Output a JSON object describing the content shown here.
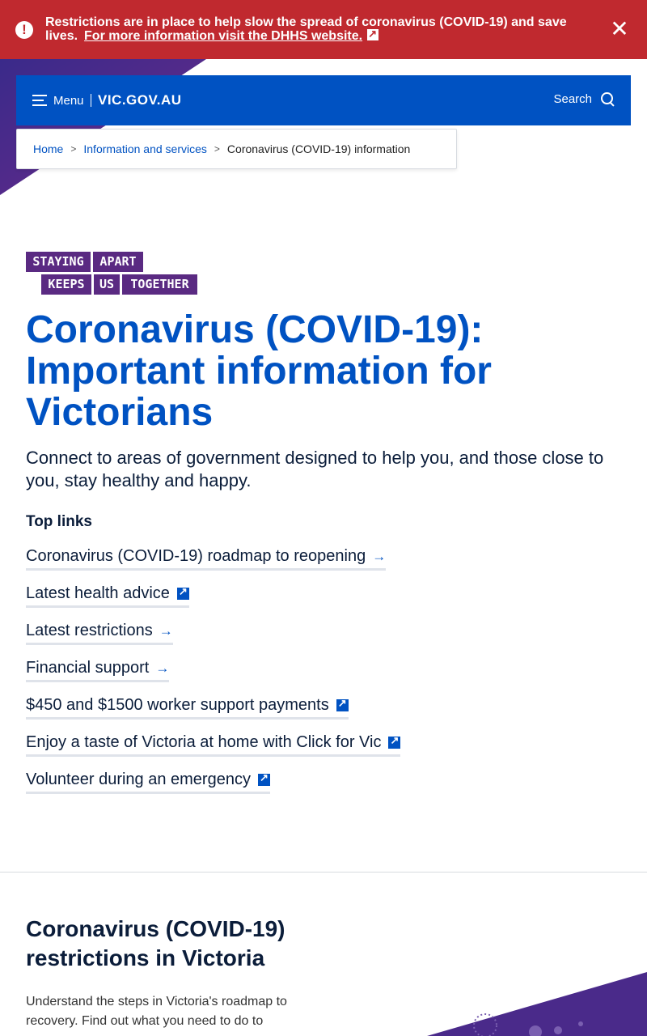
{
  "alert": {
    "message": "Restrictions are in place to help slow the spread of coronavirus (COVID-19) and save lives.",
    "link_text": "For more information visit the DHHS website.",
    "icon": "exclamation-circle-icon",
    "close_icon": "close-icon",
    "background": "#c0292f"
  },
  "nav": {
    "menu_label": "Menu",
    "brand": "VIC.GOV.AU",
    "search_label": "Search",
    "background": "#0052c2"
  },
  "breadcrumb": {
    "items": [
      "Home",
      "Information and services"
    ],
    "current": "Coronavirus (COVID-19) information"
  },
  "logo": {
    "words": [
      "STAYING",
      "APART",
      "KEEPS",
      "US",
      "TOGETHER"
    ],
    "color": "#5a2a82"
  },
  "page": {
    "title": "Coronavirus (COVID-19): Important information for Victorians",
    "intro": "Connect to areas of government designed to help you, and those close to you, stay healthy and happy.",
    "top_links_heading": "Top links"
  },
  "top_links": [
    {
      "label": "Coronavirus (COVID-19) roadmap to reopening",
      "icon": "arrow-right-icon"
    },
    {
      "label": "Latest health advice",
      "icon": "external-link-icon"
    },
    {
      "label": "Latest restrictions",
      "icon": "arrow-right-icon"
    },
    {
      "label": "Financial support",
      "icon": "arrow-right-icon"
    },
    {
      "label": "$450 and $1500 worker support payments",
      "icon": "external-link-icon"
    },
    {
      "label": "Enjoy a taste of Victoria at home with Click for Vic",
      "icon": "external-link-icon"
    },
    {
      "label": "Volunteer during an emergency",
      "icon": "external-link-icon"
    }
  ],
  "section": {
    "title": "Coronavirus (COVID-19) restrictions in Victoria",
    "text": "Understand the steps in Victoria's roadmap to recovery. Find out what you need to do to"
  },
  "colors": {
    "accent": "#0052c2",
    "purple": "#5a2a82",
    "text": "#0b1d3a"
  }
}
